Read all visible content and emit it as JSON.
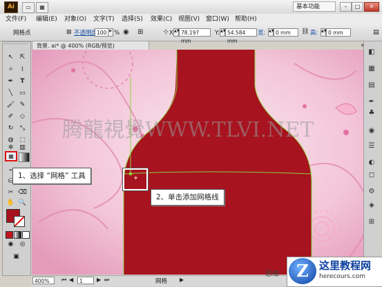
{
  "app": {
    "logo": "Ai",
    "workspace": "基本功能"
  },
  "menu": [
    "文件(F)",
    "编辑(E)",
    "对象(O)",
    "文字(T)",
    "选择(S)",
    "效果(C)",
    "视图(V)",
    "窗口(W)",
    "帮助(H)"
  ],
  "control": {
    "tool_name": "网格点",
    "opacity_label": "不透明度:",
    "opacity_value": "100",
    "opacity_unit": "%",
    "x_label": "X:",
    "x_value": "78.197 mm",
    "y_label": "Y:",
    "y_value": "54.584 mm",
    "w_label": "宽:",
    "w_value": "0 mm",
    "h_label": "高:",
    "h_value": "0 mm"
  },
  "document": {
    "tab_title": "背景. ai* @ 400% (RGB/预览)",
    "close": "×"
  },
  "status": {
    "zoom": "400%",
    "page": "1",
    "tool": "网格"
  },
  "callouts": {
    "step1": "1、选择 “网格” 工具",
    "step2": "2、单击添加网格线"
  },
  "watermark": {
    "center": "腾龍視覺WWW.TLVI.NET",
    "corner_small": "思缘",
    "brand_cn": "这里教程网",
    "brand_url": "herecours.com",
    "brand_logo": "Z"
  },
  "colors": {
    "bottle": "#a7131f",
    "mesh": "#8fd13f",
    "accent_red": "#d11111"
  }
}
